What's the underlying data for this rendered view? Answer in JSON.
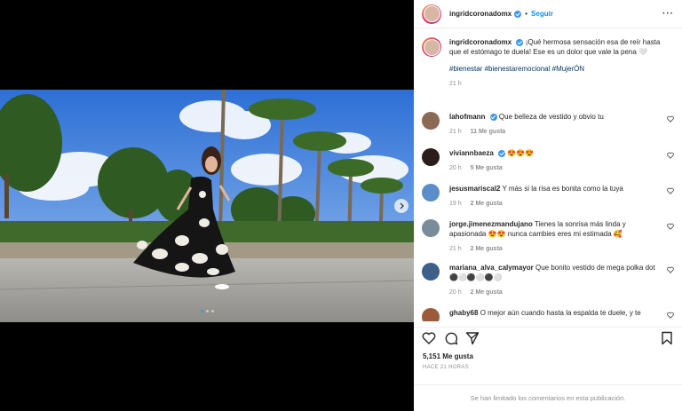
{
  "post": {
    "username": "ingridcoronadomx",
    "follow_label": "Seguir",
    "separator": "•",
    "caption": "¡Qué hermosa sensación esa de reír hasta que el estómago te duela! Ese es un dolor que vale la pena 🤍",
    "hashtags": "#bienestar #bienestaremocional #MujerÓN",
    "caption_time": "21 h",
    "likes": "5,151 Me gusta",
    "posted_ago": "HACE 21 HORAS",
    "comments_limited": "Se han limitado los comentarios en esta publicación."
  },
  "comments": [
    {
      "user": "lahofmann",
      "verified": true,
      "text": "Que belleza de vestido y obvio tu",
      "time": "21 h",
      "likes": "11 Me gusta",
      "color": "#8a6a55"
    },
    {
      "user": "viviannbaeza",
      "verified": true,
      "text": "😍😍😍",
      "time": "20 h",
      "likes": "5 Me gusta",
      "color": "#2b1e1a"
    },
    {
      "user": "jesusmariscal2",
      "verified": false,
      "text": "Y más si la risa es bonita como la tuya",
      "time": "19 h",
      "likes": "2 Me gusta",
      "color": "#5b8dc8"
    },
    {
      "user": "jorge.jimenezmandujano",
      "verified": false,
      "text": "Tienes la sonrisa más linda y apasionada 😍😍 nunca cambies eres mi estimada 🥰",
      "time": "21 h",
      "likes": "2 Me gusta",
      "color": "#7a8c9a"
    },
    {
      "user": "mariana_alva_calymayor",
      "verified": false,
      "text": "Que bonito vestido de mega polka dot ⚫⚪⚫⚪⚫⚪",
      "time": "20 h",
      "likes": "2 Me gusta",
      "color": "#3d5f8a"
    },
    {
      "user": "ghaby68",
      "verified": false,
      "text": "O mejor aún cuando hasta la espalda te duele, y te",
      "time": "",
      "likes": "",
      "color": "#9b5a3a"
    }
  ],
  "icons": {
    "more": "more-options-icon",
    "heart": "heart-icon",
    "comment": "comment-icon",
    "share": "share-icon",
    "save": "bookmark-icon",
    "next": "chevron-right-icon"
  },
  "colors": {
    "link": "#0095f6",
    "verified": "#3897f0",
    "hashtag": "#00376b",
    "muted": "#8e8e8e"
  }
}
